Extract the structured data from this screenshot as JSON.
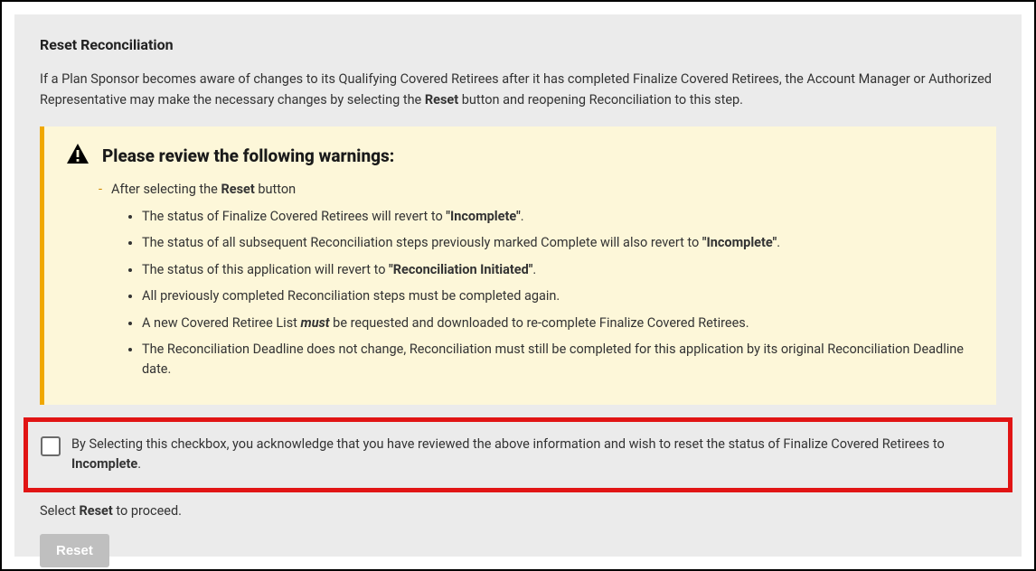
{
  "title": "Reset Reconciliation",
  "intro": {
    "pre": "If a Plan Sponsor becomes aware of changes to its Qualifying Covered Retirees after it has completed Finalize Covered Retirees, the Account Manager or Authorized Representative may make the necessary changes by selecting the ",
    "bold": "Reset",
    "post": " button and reopening Reconciliation to this step."
  },
  "warning": {
    "heading": "Please review the following warnings:",
    "lead": {
      "pre": "After selecting the ",
      "bold": "Reset",
      "post": " button"
    },
    "items": [
      {
        "pre": "The status of Finalize Covered Retirees will revert to ",
        "bold": "\"Incomplete\"",
        "post": "."
      },
      {
        "pre": "The status of all subsequent Reconciliation steps previously marked Complete will also revert to ",
        "bold": "\"Incomplete\"",
        "post": "."
      },
      {
        "pre": "The status of this application will revert to ",
        "bold": "\"Reconciliation Initiated\"",
        "post": "."
      },
      {
        "pre": "All previously completed Reconciliation steps must be completed again.",
        "bold": "",
        "post": ""
      },
      {
        "pre": "A new Covered Retiree List ",
        "must": "must",
        "post2": " be requested and downloaded to re-complete Finalize Covered Retirees."
      },
      {
        "pre": "The Reconciliation Deadline does not change, Reconciliation must still be completed for this application by its original Reconciliation Deadline date.",
        "bold": "",
        "post": ""
      }
    ]
  },
  "ack": {
    "pre": "By Selecting this checkbox, you acknowledge that you have reviewed the above information and wish to reset the status of Finalize Covered Retirees to ",
    "bold": "Incomplete",
    "post": "."
  },
  "proceed": {
    "pre": "Select ",
    "bold": "Reset",
    "post": " to proceed."
  },
  "button": {
    "reset_label": "Reset"
  }
}
